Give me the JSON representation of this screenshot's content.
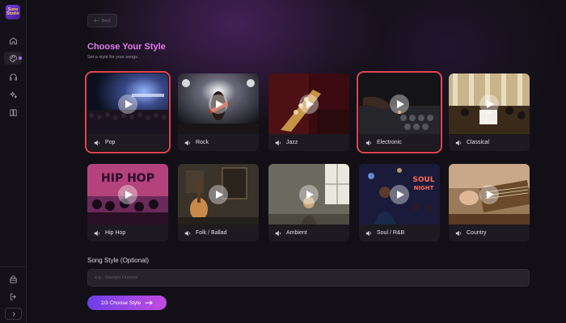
{
  "app": {
    "logo_text": "Suno Studio"
  },
  "sidebar": {
    "items": [
      {
        "icon": "home-icon"
      },
      {
        "icon": "palette-icon",
        "active": true
      },
      {
        "icon": "headphones-icon"
      },
      {
        "icon": "sparkles-icon"
      },
      {
        "icon": "book-icon"
      }
    ],
    "bottom": [
      {
        "icon": "shop-icon"
      },
      {
        "icon": "logout-icon"
      },
      {
        "icon": "chevron-right-icon"
      }
    ]
  },
  "header": {
    "back_label": "Back",
    "title": "Choose Your Style",
    "subtitle": "Set a style for your songs."
  },
  "styles": [
    {
      "label": "Pop",
      "selected": true
    },
    {
      "label": "Rock",
      "selected": false
    },
    {
      "label": "Jazz",
      "selected": false
    },
    {
      "label": "Electronic",
      "selected": true
    },
    {
      "label": "Classical",
      "selected": false
    },
    {
      "label": "Hip Hop",
      "selected": false
    },
    {
      "label": "Folk / Ballad",
      "selected": false
    },
    {
      "label": "Ambient",
      "selected": false
    },
    {
      "label": "Soul / R&B",
      "selected": false
    },
    {
      "label": "Country",
      "selected": false
    }
  ],
  "song_style": {
    "label": "Song Style (Optional)",
    "placeholder": "e.g., Starlight Dreams"
  },
  "next_button": {
    "label": "2/3 Choose Style"
  },
  "colors": {
    "accent_title": "#e27bf0",
    "selected_border": "#e0444f",
    "button_gradient_start": "#6c3fe9",
    "button_gradient_end": "#c44be0"
  }
}
